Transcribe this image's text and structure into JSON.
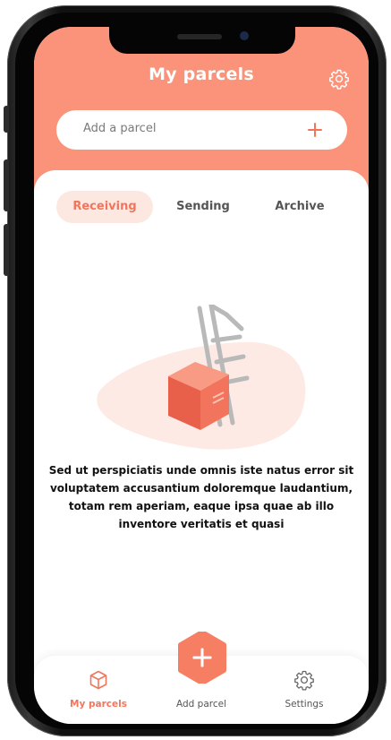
{
  "app": {
    "title": "My parcels"
  },
  "search": {
    "placeholder": "Add a parcel"
  },
  "tabs": [
    {
      "label": "Receiving",
      "active": true
    },
    {
      "label": "Sending",
      "active": false
    },
    {
      "label": "Archive",
      "active": false
    }
  ],
  "empty_state": {
    "message": "Sed ut perspiciatis unde omnis iste natus error sit voluptatem accusantium doloremque laudantium, totam rem aperiam, eaque ipsa quae ab illo inventore veritatis et quasi"
  },
  "bottom_nav": {
    "items": [
      {
        "label": "My parcels",
        "icon": "parcel-box-icon",
        "active": true
      },
      {
        "label": "Add parcel",
        "icon": "plus-icon",
        "active": false
      },
      {
        "label": "Settings",
        "icon": "gear-icon",
        "active": false
      }
    ]
  },
  "icons": {
    "header_settings": "gear-icon",
    "add_parcel": "plus-icon",
    "illustration": "box-and-ladder-illustration"
  },
  "colors": {
    "accent": "#fa9379",
    "accent_dark": "#f0765c",
    "tab_active_bg": "#fde8e1",
    "box": "#f0765c",
    "ladder": "#b9b9b9"
  }
}
